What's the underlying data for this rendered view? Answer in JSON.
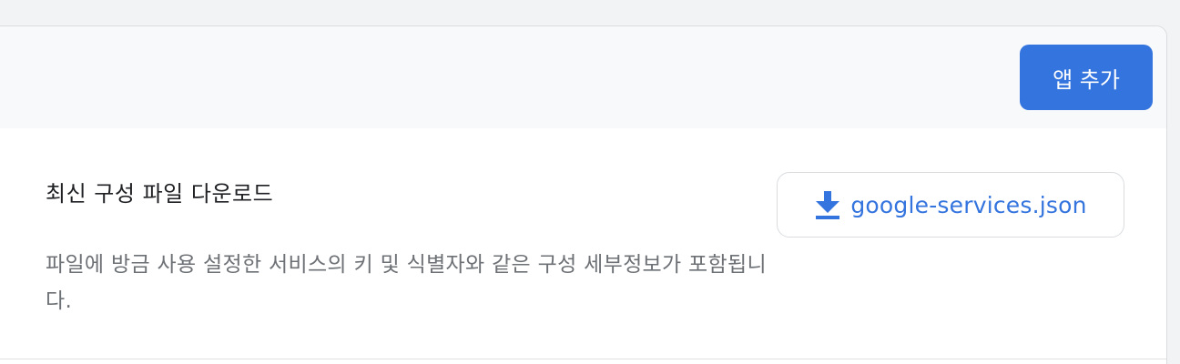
{
  "header": {
    "add_app_label": "앱 추가"
  },
  "config_section": {
    "title": "최신 구성 파일 다운로드",
    "description": "파일에 방금 사용 설정한 서비스의 키 및 식별자와 같은 구성 세부정보가 포함됩니다.",
    "download_label": "google-services.json",
    "download_icon": "download-icon"
  },
  "colors": {
    "accent": "#3474de",
    "header_bg": "#f8f9fa",
    "title_text": "#202124",
    "secondary_text": "#6d7175"
  }
}
